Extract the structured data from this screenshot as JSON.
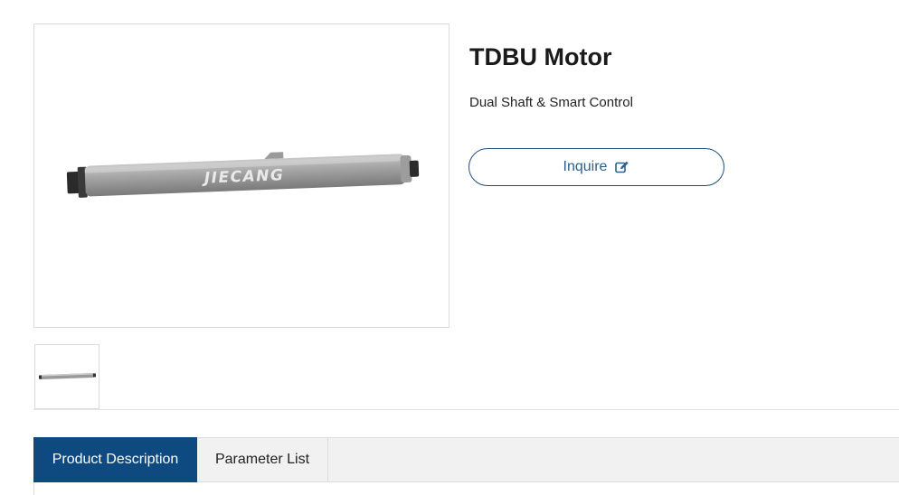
{
  "product": {
    "title": "TDBU Motor",
    "subtitle": "Dual Shaft & Smart Control",
    "brand_mark": "JIECANG"
  },
  "actions": {
    "inquire_label": "Inquire",
    "inquire_icon": "edit-icon"
  },
  "tabs": [
    {
      "label": "Product Description",
      "active": true
    },
    {
      "label": "Parameter List",
      "active": false
    }
  ],
  "colors": {
    "accent": "#0e4a80",
    "button_border": "#1f4f7d",
    "button_text": "#2d5f8f"
  }
}
